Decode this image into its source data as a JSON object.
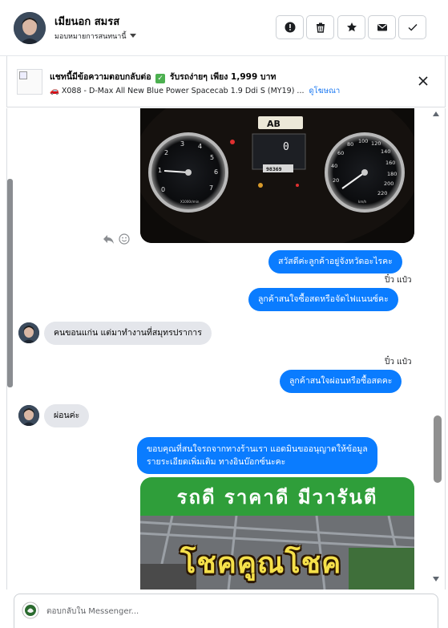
{
  "header": {
    "name": "เมียนอก สมรส",
    "assign_label": "มอบหมายการสนทนานี้",
    "actions": [
      "alert-icon",
      "trash-icon",
      "star-icon",
      "mail-icon",
      "check-icon"
    ]
  },
  "banner": {
    "title_before": "แชทนี้มีข้อความตอบกลับต่อ",
    "title_after": "รับรถง่ายๆ เพียง 1,999 บาท",
    "subtitle": "X088 - D-Max All New Blue Power Spacecab 1.9 Ddi S (MY19) ...",
    "link": "ดูโฆษณา"
  },
  "dashboard": {
    "plate": "AB",
    "odometer": "98369",
    "gear": "0"
  },
  "messages": {
    "m1": "สวัสดีค่ะลูกค้าอยู่จังหวัดอะไรคะ",
    "sender1": "ปิ๋ว แป๋ว",
    "m2": "ลูกค้าสนใจซื้อสดหรือจัดไฟแนนซ์คะ",
    "m3": "คนขอนแก่น แต่มาทำงานที่สมุทรปราการ",
    "sender2": "ปิ๋ว แป๋ว",
    "m4": "ลูกค้าสนใจผ่อนหรือซื้อสดคะ",
    "m5": "ผ่อนค่ะ",
    "m6_line1": "ขอบคุณที่สนใจรถจากทางร้านเรา แอดมินขออนุญาตให้ข้อมูล",
    "m6_line2": "รายระเอียดเพิ่มเติม ทางอินบ๊อกซ์นะคะ"
  },
  "promo": {
    "top_text": "รถดี  ราคาดี  มีวารันตี",
    "main_text": "โชคคูณโชค"
  },
  "composer": {
    "placeholder": "ตอบกลับใน Messenger..."
  },
  "colors": {
    "outgoing_bubble": "#0a7cff",
    "incoming_bubble": "#e4e6eb",
    "promo_green": "#2f9e3a",
    "promo_yellow": "#f5e04a"
  }
}
